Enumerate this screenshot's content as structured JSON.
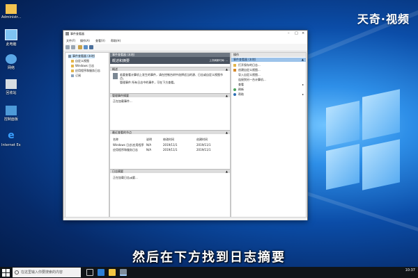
{
  "watermark": "天奇·视频",
  "subtitle": "然后在下方找到日志摘要",
  "desktop_icons": [
    {
      "label": "Administr..."
    },
    {
      "label": "此电脑"
    },
    {
      "label": "网络"
    },
    {
      "label": "回收站"
    },
    {
      "label": "控制面板"
    },
    {
      "label": "Internet Explorer"
    }
  ],
  "taskbar": {
    "search_placeholder": "在这里输入你要搜索的内容",
    "clock": "10:37"
  },
  "window": {
    "title": "事件查看器",
    "menu": [
      "文件(F)",
      "操作(A)",
      "查看(V)",
      "帮助(H)"
    ],
    "tree": [
      {
        "label": "事件查看器 (本地)",
        "selected": true
      },
      {
        "label": "自定义视图"
      },
      {
        "label": "Windows 日志"
      },
      {
        "label": "应用程序和服务日志"
      },
      {
        "label": "订阅"
      }
    ],
    "center": {
      "header": "事件查看器 (本地)",
      "banner_title": "概述和摘要",
      "banner_right": "上次刷新时间: ...",
      "overview_header": "概述",
      "overview_text_1": "若要查看计算机上发生的事件，请在控制台树中选择适当的源、日志或自定义视图节点。",
      "overview_text_2": "管理事件 所有日志中的事件，可在下方查看。",
      "summary_header": "管理事件摘要",
      "summary_text": "正在加载事件...",
      "recent_header": "最近查看的节点",
      "recent_cols": [
        "名称",
        "说明",
        "修改时间",
        "创建时间"
      ],
      "recent_rows": [
        [
          "Windows 日志\\应用程序",
          "N/A",
          "2019/11/1",
          "2019/11/1"
        ],
        [
          "应用程序和服务日志",
          "N/A",
          "2019/11/1",
          "2019/11/1"
        ]
      ],
      "log_summary_header": "日志摘要",
      "log_summary_text": "正在加载日志摘要..."
    },
    "actions": {
      "header": "操作",
      "section": "事件查看器 (本地)",
      "items": [
        {
          "label": "打开保存的日志...",
          "chevron": false
        },
        {
          "label": "创建自定义视图...",
          "chevron": false
        },
        {
          "label": "导入自定义视图...",
          "chevron": false
        },
        {
          "label": "连接到另一台计算机...",
          "chevron": false
        },
        {
          "label": "查看",
          "chevron": true
        },
        {
          "label": "刷新",
          "chevron": false
        },
        {
          "label": "帮助",
          "chevron": true
        }
      ]
    }
  }
}
